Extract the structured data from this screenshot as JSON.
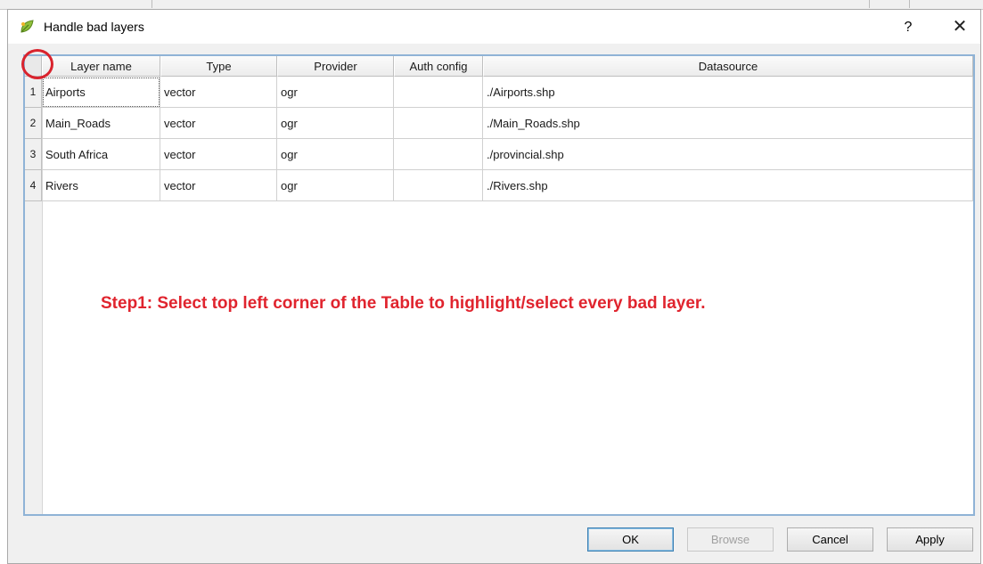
{
  "window": {
    "title": "Handle bad layers",
    "help_label": "?",
    "close_label": "✕",
    "icon": "qgis-leaf-icon"
  },
  "table": {
    "columns": [
      "Layer name",
      "Type",
      "Provider",
      "Auth config",
      "Datasource"
    ],
    "rows": [
      {
        "num": "1",
        "cells": [
          "Airports",
          "vector",
          "ogr",
          "",
          "./Airports.shp"
        ]
      },
      {
        "num": "2",
        "cells": [
          "Main_Roads",
          "vector",
          "ogr",
          "",
          "./Main_Roads.shp"
        ]
      },
      {
        "num": "3",
        "cells": [
          "South Africa",
          "vector",
          "ogr",
          "",
          "./provincial.shp"
        ]
      },
      {
        "num": "4",
        "cells": [
          "Rivers",
          "vector",
          "ogr",
          "",
          "./Rivers.shp"
        ]
      }
    ]
  },
  "annotation": {
    "text": "Step1: Select top left corner of the Table to highlight/select every bad layer.",
    "color": "#e0242e"
  },
  "buttons": {
    "ok": "OK",
    "browse": "Browse",
    "cancel": "Cancel",
    "apply": "Apply"
  },
  "colors": {
    "frame_border": "#8fb3d6",
    "highlight_circle": "#d9232d"
  }
}
